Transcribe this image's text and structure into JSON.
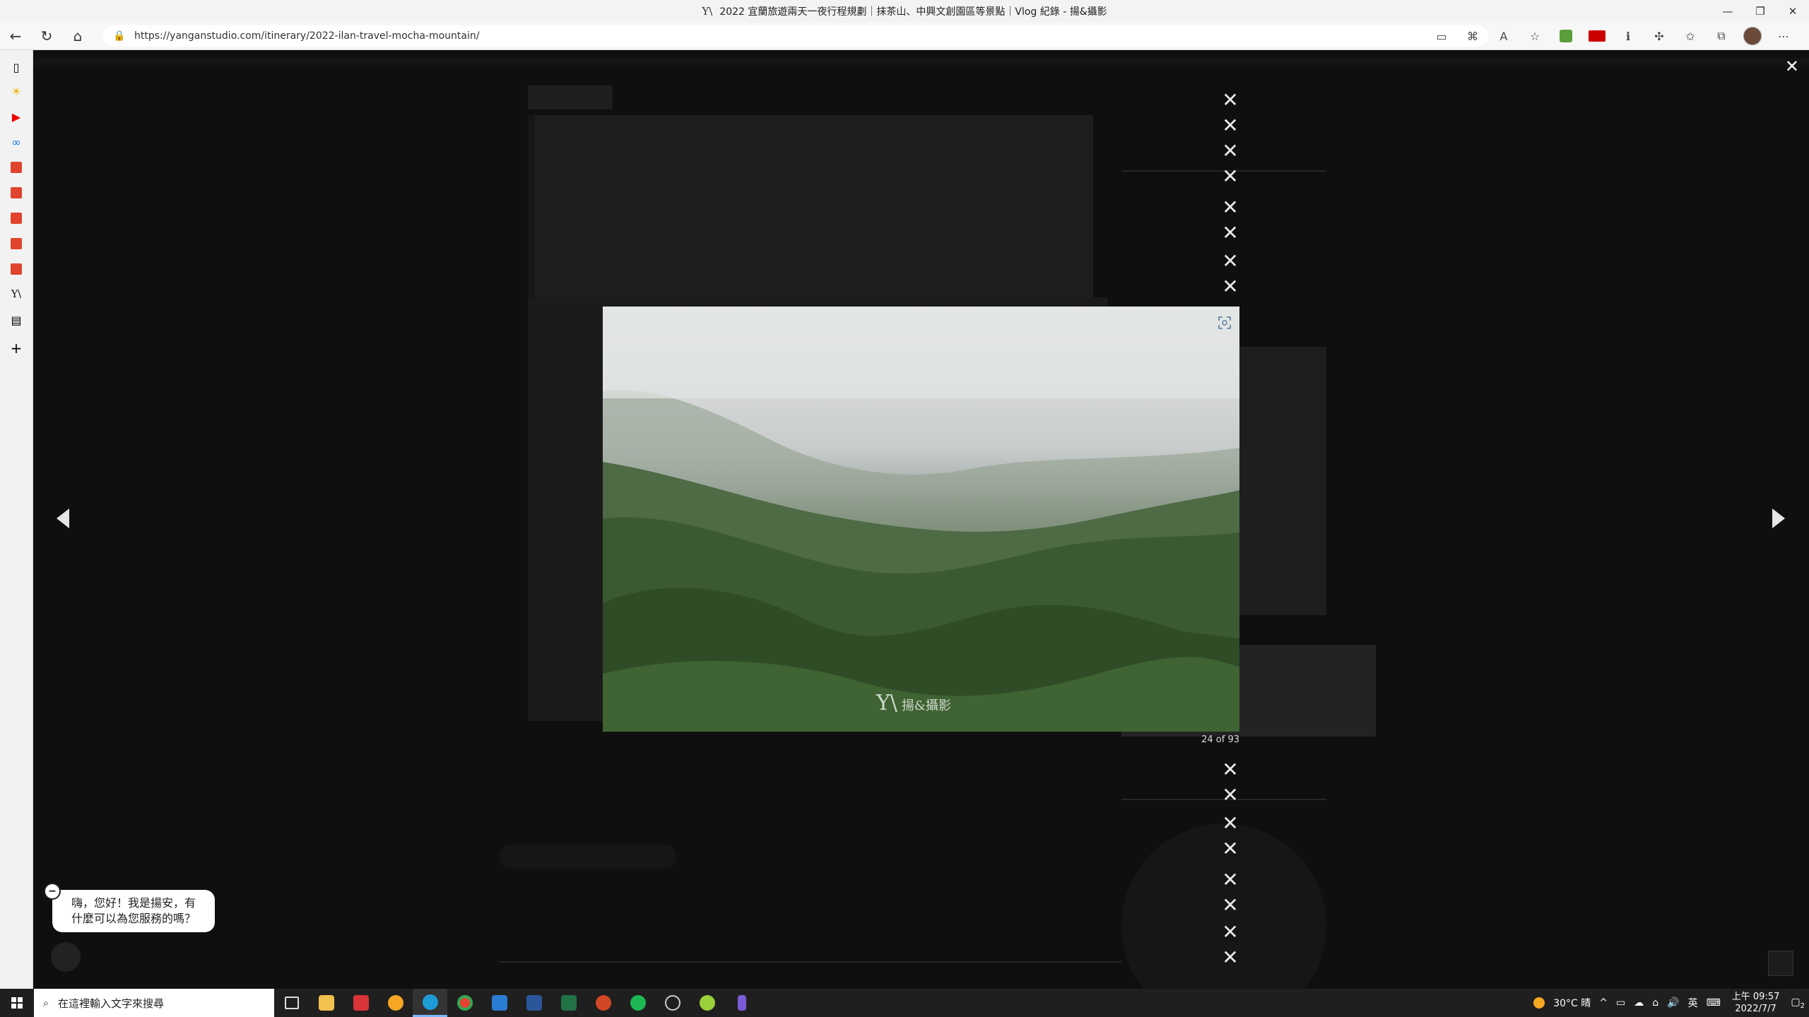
{
  "browser": {
    "title": "2022 宜蘭旅遊兩天一夜行程規劃｜抹茶山、中興文創園區等景點｜Vlog 紀錄 - 揚&攝影",
    "title_logo": "Y\\",
    "url": "https://yanganstudio.com/itinerary/2022-ilan-travel-mocha-mountain/",
    "window_controls": [
      "—",
      "❐",
      "✕"
    ]
  },
  "lightbox": {
    "close_glyph": "✕",
    "x_glyph": "✕",
    "counter": "24 of 93",
    "watermark_logo": "Y\\",
    "watermark_text": "揚&攝影"
  },
  "chat": {
    "minimize": "−",
    "message_line1": "嗨，您好！我是揚安，有",
    "message_line2": "什麼可以為您服務的嗎？"
  },
  "taskbar": {
    "search_placeholder": "在這裡輸入文字來搜尋",
    "weather": "30°C 晴",
    "lang": "英",
    "time": "上午 09:57",
    "date": "2022/7/7",
    "notification_count": "2"
  },
  "colors": {
    "page_overlay": "#0f0f0f",
    "taskbar": "#1f1f1f",
    "accent_red": "#cc0000"
  }
}
